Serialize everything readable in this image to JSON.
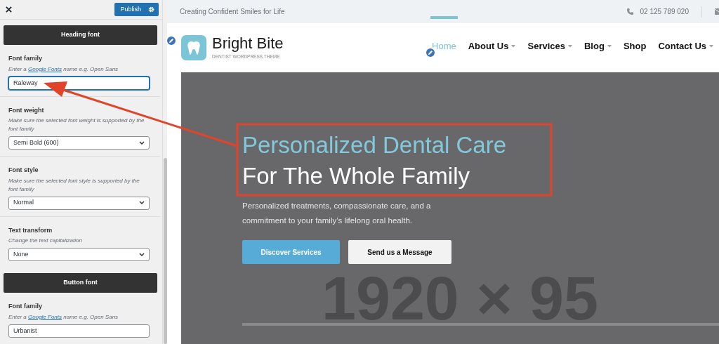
{
  "customizer": {
    "publish_button": "Publish",
    "sections": [
      {
        "kind": "header",
        "title": "Heading font"
      },
      {
        "kind": "text",
        "label": "Font family",
        "hint_before": "Enter a ",
        "hint_link": "Google Fonts",
        "hint_after": " name e.g. Open Sans",
        "value": "Raleway",
        "focused": true
      },
      {
        "kind": "select",
        "label": "Font weight",
        "hint": "Make sure the selected font weight is supported by the font family",
        "value": "Semi Bold (600)"
      },
      {
        "kind": "select",
        "label": "Font style",
        "hint": "Make sure the selected font style is supported by the font family",
        "value": "Normal"
      },
      {
        "kind": "select",
        "label": "Text transform",
        "hint": "Change the text capitalization",
        "value": "None"
      },
      {
        "kind": "header",
        "title": "Button font"
      },
      {
        "kind": "text",
        "label": "Font family",
        "hint_before": "Enter a ",
        "hint_link": "Google Fonts",
        "hint_after": " name e.g. Open Sans",
        "value": "Urbanist",
        "focused": false
      }
    ]
  },
  "site": {
    "tagline": "Creating Confident Smiles for Life",
    "phone": "02 125 789 020",
    "brand": "Bright Bite",
    "brand_subtitle": "DENTIST WORDPRESS THEME",
    "nav": [
      {
        "label": "Home",
        "selected": true,
        "dropdown": false
      },
      {
        "label": "About Us",
        "selected": false,
        "dropdown": true
      },
      {
        "label": "Services",
        "selected": false,
        "dropdown": true
      },
      {
        "label": "Blog",
        "selected": false,
        "dropdown": true
      },
      {
        "label": "Shop",
        "selected": false,
        "dropdown": false
      },
      {
        "label": "Contact Us",
        "selected": false,
        "dropdown": true
      }
    ],
    "hero": {
      "title_line_1": "Personalized Dental Care",
      "title_line_2": "For The Whole Family",
      "text": "Personalized treatments, compassionate care, and a commitment to your family’s lifelong oral health.",
      "placeholder_text": "1920 × 95",
      "buttons": [
        {
          "label": "Discover Services",
          "kind": "primary"
        },
        {
          "label": "Send us a Message",
          "kind": "secondary"
        }
      ]
    }
  }
}
